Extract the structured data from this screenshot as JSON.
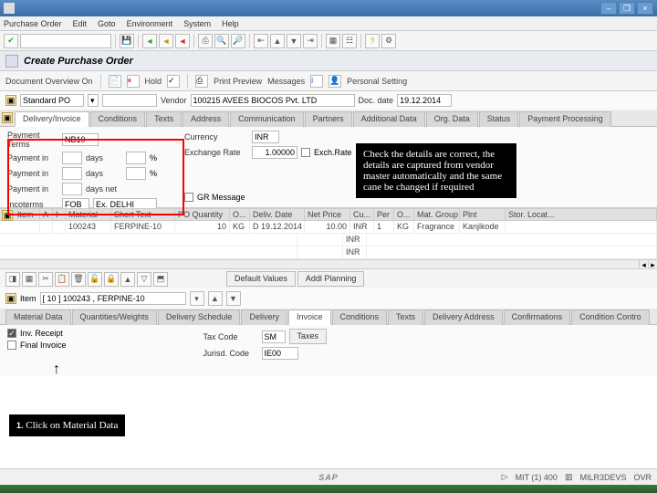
{
  "window": {
    "title": "Purchase Order   Edit   Goto   Environment   System   Help"
  },
  "menu": [
    "Purchase Order",
    "Edit",
    "Goto",
    "Environment",
    "System",
    "Help"
  ],
  "page_title": "Create Purchase Order",
  "subbar": {
    "overview": "Document Overview On",
    "hold": "Hold",
    "preview": "Print Preview",
    "messages": "Messages",
    "personal": "Personal Setting"
  },
  "header": {
    "doctype": "Standard PO",
    "doctype_code": "",
    "vendor_lbl": "Vendor",
    "vendor": "100215 AVEES BIOCOS Pvt. LTD",
    "docdate_lbl": "Doc. date",
    "docdate": "19.12.2014"
  },
  "htabs": [
    "Delivery/Invoice",
    "Conditions",
    "Texts",
    "Address",
    "Communication",
    "Partners",
    "Additional Data",
    "Org. Data",
    "Status",
    "Payment Processing"
  ],
  "pay": {
    "terms_lbl": "Payment Terms",
    "terms": "NB10",
    "in_lbl": "Payment in",
    "days_lbl": "days",
    "pct": "%",
    "net_lbl": "days net",
    "incoterms_lbl": "Incoterms",
    "inco1": "FOB",
    "inco2": "Ex. DELHI",
    "currency_lbl": "Currency",
    "currency": "INR",
    "exch_lbl": "Exchange Rate",
    "exch": "1.00000",
    "exch_fixed": "Exch.Rate Fixed",
    "gr_msg": "GR Message"
  },
  "cols": [
    "Item",
    "A",
    "I",
    "Material",
    "Short Text",
    "PO Quantity",
    "O...",
    "Deliv. Date",
    "Net Price",
    "Cu...",
    "Per",
    "O...",
    "Mat. Group",
    "Plnt",
    "Stor. Locat..."
  ],
  "row1": {
    "item": "",
    "a": "",
    "i": "",
    "mat": "100243",
    "stext": "FERPINE-10",
    "qty": "10",
    "ou": "KG",
    "date": "D 19.12.2014",
    "price": "10.00",
    "cur": "INR",
    "per": "1",
    "ou2": "KG",
    "mgrp": "Fragrance",
    "plnt": "Kanjikode"
  },
  "tools": {
    "defaults": "Default Values",
    "addl": "Addl Planning"
  },
  "item_sel_lbl": "Item",
  "item_sel": "[ 10 ] 100243 , FERPINE-10",
  "itabs": [
    "Material Data",
    "Quantities/Weights",
    "Delivery Schedule",
    "Delivery",
    "Invoice",
    "Conditions",
    "Texts",
    "Delivery Address",
    "Confirmations",
    "Condition Contro"
  ],
  "inv": {
    "ir_lbl": "Inv. Receipt",
    "fi_lbl": "Final Invoice",
    "tax_lbl": "Tax Code",
    "tax": "SM",
    "taxes_btn": "Taxes",
    "jur_lbl": "Jurisd. Code",
    "jur": "IE00"
  },
  "annot1": "Check the details are correct, the details are captured from vendor master automatically and the same cane be changed if required",
  "annot2": "1. Click on Material Data",
  "status": {
    "sys": "MIT (1) 400",
    "srv": "MILR3DEVS",
    "mode": "OVR"
  }
}
